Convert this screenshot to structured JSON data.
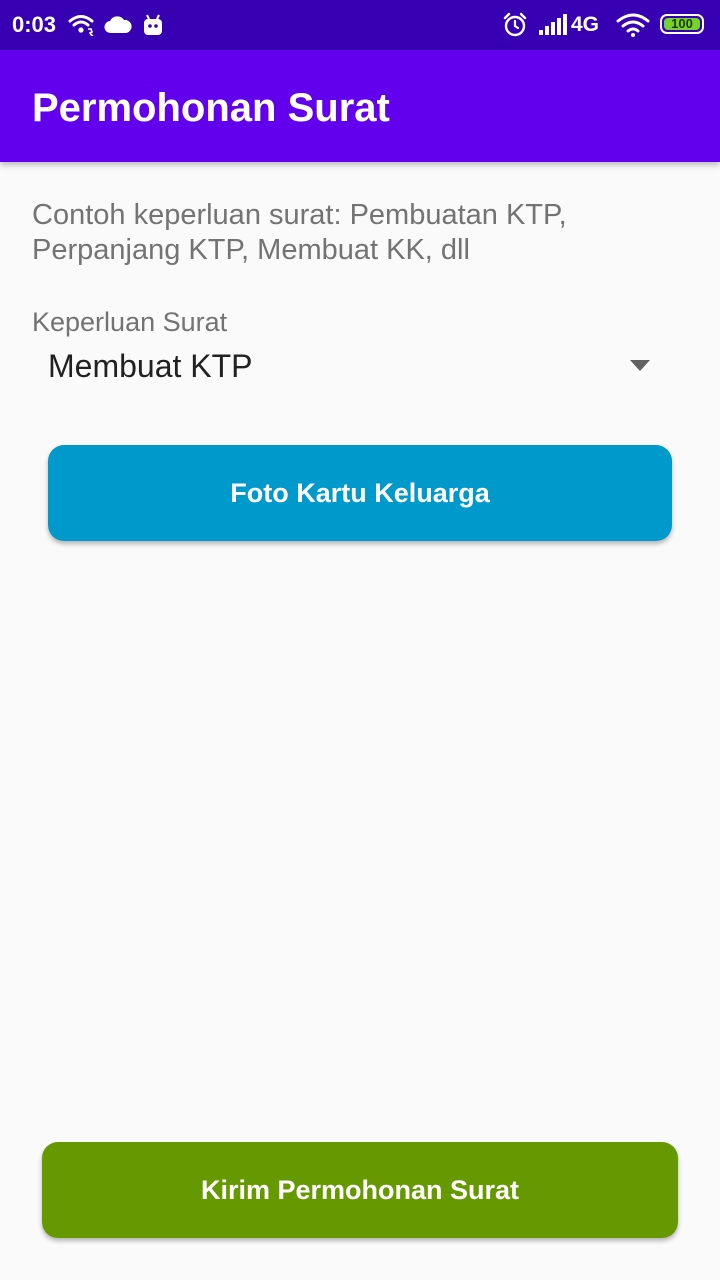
{
  "status_bar": {
    "time": "0:03",
    "network": "4G",
    "battery": "100",
    "colors": {
      "background": "#3700b3"
    },
    "icons": [
      "wifi-calling-icon",
      "cloud-icon",
      "android-icon",
      "alarm-icon",
      "signal-icon",
      "wifi-icon",
      "battery-icon"
    ]
  },
  "app_bar": {
    "title": "Permohonan Surat",
    "color": "#6200ee"
  },
  "form": {
    "hint": "Contoh keperluan surat: Pembuatan KTP, Perpanjang KTP, Membuat KK, dll",
    "purpose_label": "Keperluan Surat",
    "purpose_selected": "Membuat KTP",
    "photo_button_label": "Foto Kartu Keluarga",
    "photo_button_color": "#0099cc",
    "submit_button_label": "Kirim Permohonan Surat",
    "submit_button_color": "#669900"
  }
}
